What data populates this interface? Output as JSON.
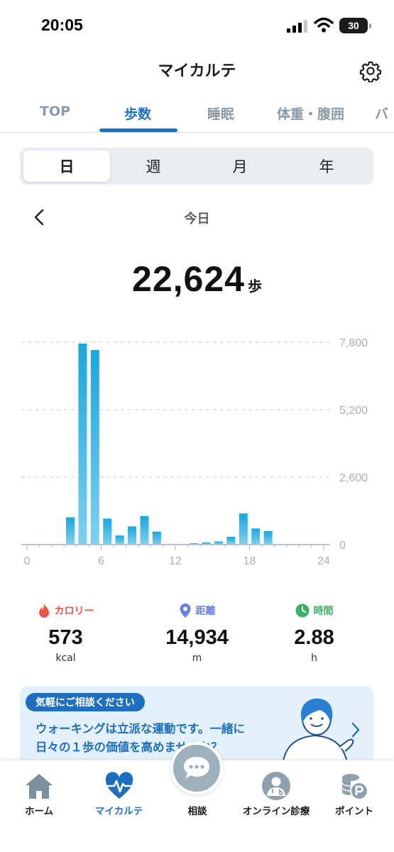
{
  "status_bar": {
    "time": "20:05",
    "battery": "30"
  },
  "header": {
    "title": "マイカルテ"
  },
  "tabs": [
    {
      "label": "TOP",
      "active": false
    },
    {
      "label": "歩数",
      "active": true
    },
    {
      "label": "睡眠",
      "active": false
    },
    {
      "label": "体重・腹囲",
      "active": false
    },
    {
      "label": "バ",
      "active": false
    }
  ],
  "periods": [
    {
      "label": "日",
      "active": true
    },
    {
      "label": "週",
      "active": false
    },
    {
      "label": "月",
      "active": false
    },
    {
      "label": "年",
      "active": false
    }
  ],
  "date_nav": {
    "label": "今日"
  },
  "total": {
    "value": "22,624",
    "unit": "歩"
  },
  "chart_data": {
    "type": "bar",
    "title": "",
    "xlabel": "",
    "ylabel": "",
    "x": [
      0,
      1,
      2,
      3,
      4,
      5,
      6,
      7,
      8,
      9,
      10,
      11,
      12,
      13,
      14,
      15,
      16,
      17,
      18,
      19,
      20,
      21,
      22,
      23
    ],
    "values": [
      0,
      0,
      0,
      1050,
      7750,
      7500,
      1000,
      350,
      700,
      1100,
      500,
      30,
      0,
      50,
      80,
      120,
      300,
      1200,
      620,
      520,
      0,
      0,
      0,
      0
    ],
    "xticks": [
      "0",
      "6",
      "12",
      "18",
      "24"
    ],
    "yticks": [
      "0",
      "2,600",
      "5,200",
      "7,800"
    ],
    "ylim": [
      0,
      7800
    ],
    "grid": true,
    "color": "#33b3e3"
  },
  "stats": [
    {
      "label": "カロリー",
      "value": "573",
      "unit": "kcal",
      "icon": "flame-icon",
      "color": "#e9554a"
    },
    {
      "label": "距離",
      "value": "14,934",
      "unit": "m",
      "icon": "location-pin-icon",
      "color": "#6a7fe0"
    },
    {
      "label": "時間",
      "value": "2.88",
      "unit": "h",
      "icon": "clock-icon",
      "color": "#3fae6a"
    }
  ],
  "banner": {
    "tag": "気軽にご相談ください",
    "text_line1": "ウォーキングは立派な運動です。一緒に",
    "text_line2": "日々の１歩の価値を高めませんか？"
  },
  "bottom_nav": [
    {
      "label": "ホーム",
      "icon": "home-icon",
      "active": false
    },
    {
      "label": "マイカルテ",
      "icon": "heart-pulse-icon",
      "active": true
    },
    {
      "label": "相談",
      "icon": "chat-bubble-icon",
      "active": false
    },
    {
      "label": "オンライン診療",
      "icon": "doctor-icon",
      "active": false
    },
    {
      "label": "ポイント",
      "icon": "point-coins-icon",
      "active": false
    }
  ],
  "colors": {
    "accent": "#1f6fbf",
    "bar": "#33b3e3",
    "muted": "#8d9aa6"
  }
}
